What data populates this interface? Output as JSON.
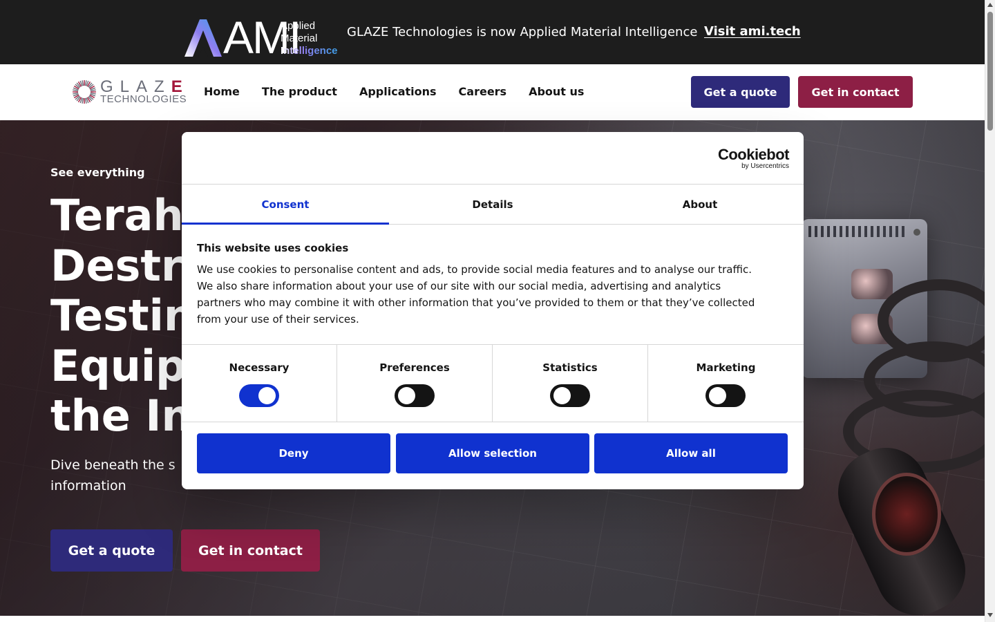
{
  "topbar": {
    "logo_word": "AMI",
    "logo_lines": [
      "Applied",
      "Material",
      "Intelligence"
    ],
    "message": "GLAZE Technologies is now Applied Material Intelligence",
    "link": "Visit ami.tech"
  },
  "nav": {
    "logo_word_a": "GLAZ",
    "logo_word_b": "E",
    "logo_sub": "TECHNOLOGIES",
    "items": [
      "Home",
      "The product",
      "Applications",
      "Careers",
      "About us"
    ],
    "quote_button": "Get a quote",
    "contact_button": "Get in contact"
  },
  "hero": {
    "kicker": "See everything",
    "title_lines": [
      "Terah",
      "Destru",
      "Testin",
      "Equip",
      "the In"
    ],
    "subtitle_lines": [
      "Dive beneath the s",
      "information"
    ],
    "quote_button": "Get a quote",
    "contact_button": "Get in contact"
  },
  "cookie_dialog": {
    "brand_main": "Cookiebot",
    "brand_sub": "by Usercentrics",
    "tabs": [
      "Consent",
      "Details",
      "About"
    ],
    "active_tab": "Consent",
    "title": "This website uses cookies",
    "text": "We use cookies to personalise content and ads, to provide social media features and to analyse our traffic. We also share information about your use of our site with our social media, advertising and analytics partners who may combine it with other information that you’ve provided to them or that they’ve collected from your use of their services.",
    "categories": [
      {
        "label": "Necessary",
        "enabled": true
      },
      {
        "label": "Preferences",
        "enabled": false
      },
      {
        "label": "Statistics",
        "enabled": false
      },
      {
        "label": "Marketing",
        "enabled": false
      }
    ],
    "buttons": [
      "Deny",
      "Allow selection",
      "Allow all"
    ]
  },
  "colors": {
    "topbar_bg": "#1d1d1d",
    "brand_purple": "#2e2a7a",
    "brand_crimson": "#8d1f45",
    "cookie_blue": "#1032cf"
  }
}
